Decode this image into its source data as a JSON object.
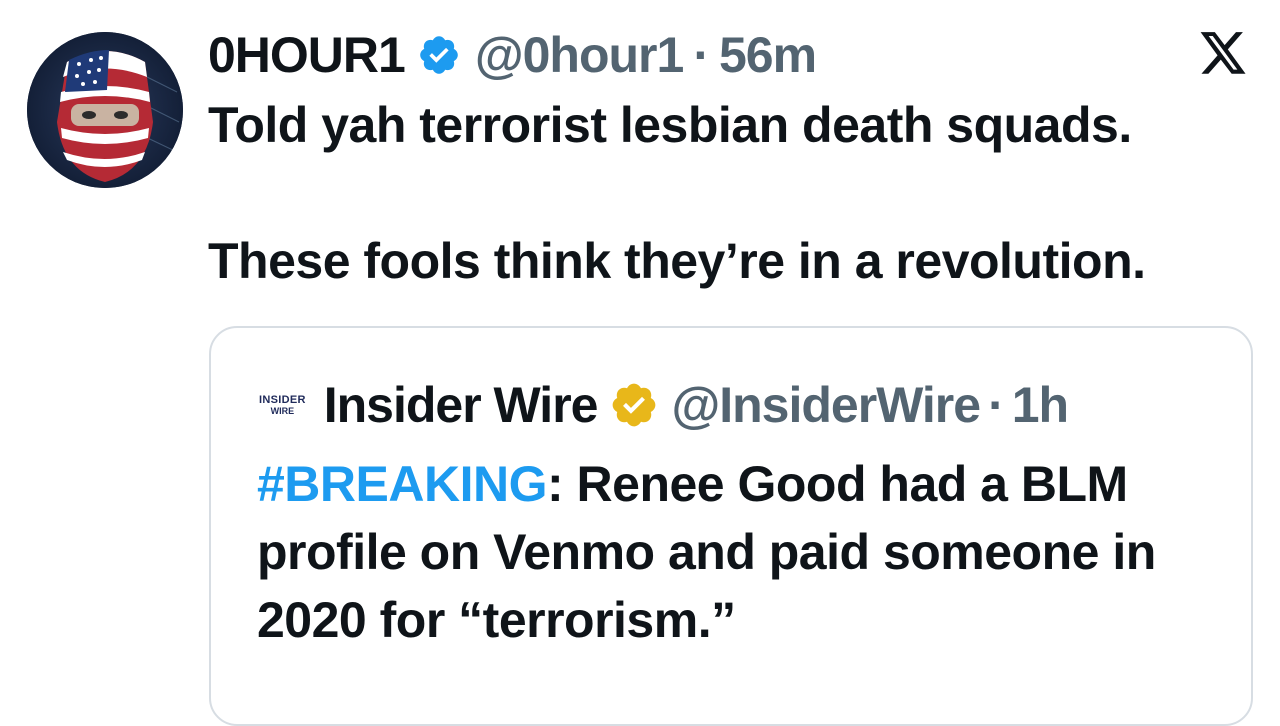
{
  "author": {
    "display_name": "0HOUR1",
    "handle": "@0hour1",
    "separator": "·",
    "time": "56m",
    "verified_color": "#1d9bf0",
    "avatar_icon": "masked-face-flag-avatar"
  },
  "platform_icon": "x-logo-icon",
  "tweet": {
    "line1": "Told yah terrorist lesbian death squads.",
    "line2": "These fools think they’re in a revolution."
  },
  "quote": {
    "logo_line1": "INSIDER",
    "logo_line2": "WIRE",
    "display_name": "Insider Wire",
    "handle": "@InsiderWire",
    "separator": "·",
    "time": "1h",
    "verified_color": "#e8b71a",
    "hashtag": "#BREAKING",
    "text_after_hashtag": ": Renee Good had a BLM profile on Venmo and paid someone in 2020 for “terrorism.”",
    "hashtag_color": "#1d9bf0"
  }
}
